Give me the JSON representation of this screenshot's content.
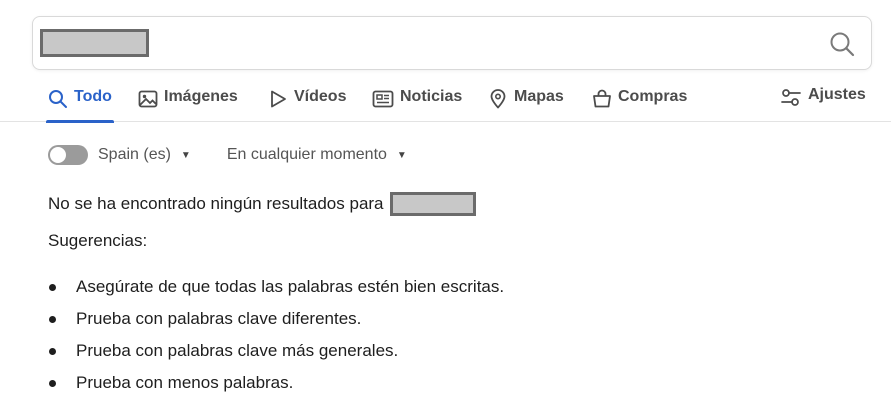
{
  "search": {
    "query_redacted": true
  },
  "tabs": [
    {
      "id": "all",
      "label": "Todo",
      "icon": "search-icon",
      "active": true
    },
    {
      "id": "images",
      "label": "Imágenes",
      "icon": "image-icon"
    },
    {
      "id": "videos",
      "label": "Vídeos",
      "icon": "play-icon"
    },
    {
      "id": "news",
      "label": "Noticias",
      "icon": "newspaper-icon"
    },
    {
      "id": "maps",
      "label": "Mapas",
      "icon": "map-pin-icon"
    },
    {
      "id": "shopping",
      "label": "Compras",
      "icon": "shopping-bag-icon"
    }
  ],
  "settings": {
    "label": "Ajustes",
    "icon": "sliders-icon"
  },
  "filters": {
    "region": "Spain (es)",
    "region_toggle_on": false,
    "time": "En cualquier momento"
  },
  "results": {
    "no_results_text": "No se ha encontrado ningún resultados para",
    "suggestions_title": "Sugerencias:",
    "tips": [
      "Asegúrate de que todas las palabras estén bien escritas.",
      "Prueba con palabras clave diferentes.",
      "Prueba con palabras clave más generales.",
      "Prueba con menos palabras."
    ]
  },
  "colors": {
    "accent": "#2a62c9",
    "text": "#1e1e1e",
    "muted": "#555555",
    "toggle_off": "#9b9b9b"
  }
}
